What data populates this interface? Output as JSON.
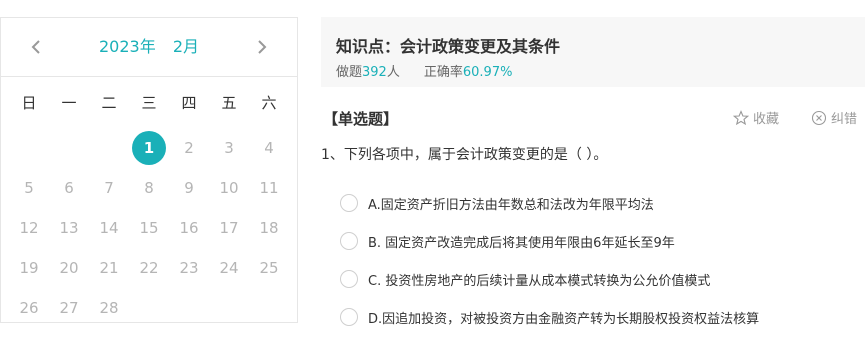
{
  "calendar": {
    "year": "2023年",
    "month": "2月",
    "weekdays": [
      "日",
      "一",
      "二",
      "三",
      "四",
      "五",
      "六"
    ],
    "weeks": [
      [
        "",
        "",
        "",
        "1",
        "2",
        "3",
        "4"
      ],
      [
        "5",
        "6",
        "7",
        "8",
        "9",
        "10",
        "11"
      ],
      [
        "12",
        "13",
        "14",
        "15",
        "16",
        "17",
        "18"
      ],
      [
        "19",
        "20",
        "21",
        "22",
        "23",
        "24",
        "25"
      ],
      [
        "26",
        "27",
        "28",
        "",
        "",
        "",
        ""
      ]
    ],
    "selected_day": "1",
    "accent_color": "#1ab0b8"
  },
  "knowledge": {
    "title": "知识点：会计政策变更及其条件",
    "attempts_label": "做题",
    "attempts_value": "392",
    "attempts_unit": "人",
    "accuracy_label": "正确率",
    "accuracy_value": "60.97%"
  },
  "question": {
    "type": "【单选题】",
    "favorite_label": "收藏",
    "report_label": "纠错",
    "text": "1、下列各项中，属于会计政策变更的是（ ）。",
    "options": [
      "A.固定资产折旧方法由年数总和法改为年限平均法",
      "B. 固定资产改造完成后将其使用年限由6年延长至9年",
      "C. 投资性房地产的后续计量从成本模式转换为公允价值模式",
      "D.因追加投资，对被投资方由金融资产转为长期股权投资权益法核算"
    ]
  }
}
